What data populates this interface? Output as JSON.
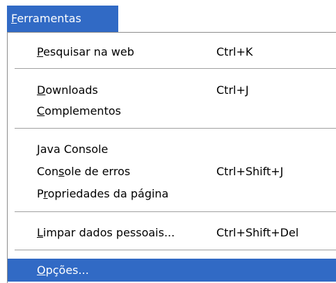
{
  "menubar": {
    "active_menu": {
      "pre": "",
      "accel": "F",
      "post": "erramentas"
    }
  },
  "menu": {
    "items": [
      {
        "pre": "",
        "accel": "P",
        "post": "esquisar na web",
        "shortcut": "Ctrl+K"
      },
      {
        "pre": "",
        "accel": "D",
        "post": "ownloads",
        "shortcut": "Ctrl+J"
      },
      {
        "pre": "",
        "accel": "C",
        "post": "omplementos",
        "shortcut": ""
      },
      {
        "pre": "",
        "accel": "J",
        "post": "ava Console",
        "shortcut": ""
      },
      {
        "pre": "Con",
        "accel": "s",
        "post": "ole de erros",
        "shortcut": "Ctrl+Shift+J"
      },
      {
        "pre": "P",
        "accel": "r",
        "post": "opriedades da página",
        "shortcut": ""
      },
      {
        "pre": "",
        "accel": "L",
        "post": "impar dados pessoais...",
        "shortcut": "Ctrl+Shift+Del"
      },
      {
        "pre": "",
        "accel": "O",
        "post": "pções...",
        "shortcut": ""
      }
    ]
  },
  "colors": {
    "highlight": "#316ac5",
    "highlight_text": "#ffffff"
  }
}
